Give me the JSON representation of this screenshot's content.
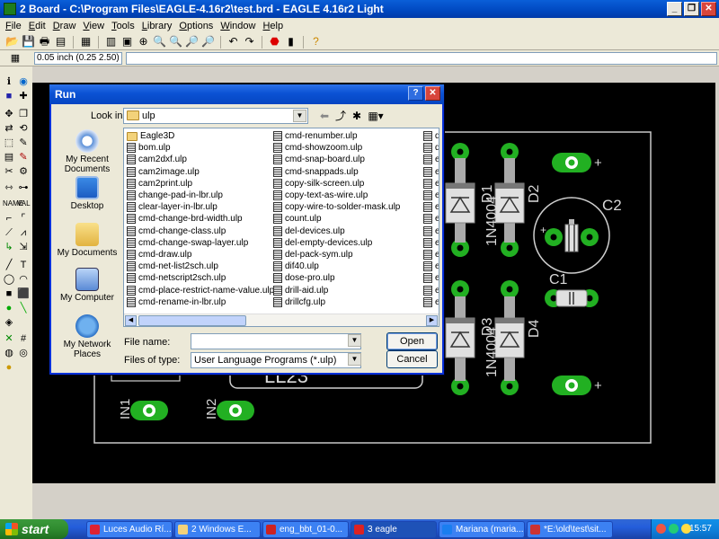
{
  "window": {
    "title": "2 Board - C:\\Program Files\\EAGLE-4.16r2\\test.brd - EAGLE 4.16r2 Light",
    "minimize": "_",
    "maximize": "❐",
    "close": "✕"
  },
  "menu": [
    "File",
    "Edit",
    "Draw",
    "View",
    "Tools",
    "Library",
    "Options",
    "Window",
    "Help"
  ],
  "toolbar_icons": [
    "open-icon",
    "save-icon",
    "print-icon",
    "cam-icon",
    "board-icon",
    "script-icon",
    "ulp-icon",
    "zoom-fit-icon",
    "zoom-in-icon",
    "zoom-out-icon",
    "zoom-redraw-icon",
    "zoom-area-icon",
    "undo-icon",
    "redo-icon",
    "stop-icon",
    "go-icon",
    "help-icon"
  ],
  "coordinates": "0.05 inch (0.25 2.50)",
  "pcb": {
    "labels": {
      "d1": "1N4004",
      "d1_ref": "D1",
      "d2": "D2",
      "c2": "C2",
      "c1": "C1",
      "d3": "1N4004",
      "d3_ref": "D3",
      "d4": "D4",
      "in1": "IN1",
      "in2": "IN2",
      "ll": "LL23",
      "plus1": "+",
      "plus2": "+",
      "plus3": "+"
    }
  },
  "run_dialog": {
    "title": "Run",
    "help_btn": "?",
    "close_btn": "✕",
    "look_in_label": "Look in:",
    "look_in_value": "ulp",
    "places": [
      "My Recent Documents",
      "Desktop",
      "My Documents",
      "My Computer",
      "My Network Places"
    ],
    "files_col1": [
      "Eagle3D",
      "bom.ulp",
      "cam2dxf.ulp",
      "cam2image.ulp",
      "cam2print.ulp",
      "change-pad-in-lbr.ulp",
      "clear-layer-in-lbr.ulp",
      "cmd-change-brd-width.ulp",
      "cmd-change-class.ulp",
      "cmd-change-swap-layer.ulp",
      "cmd-draw.ulp",
      "cmd-net-list2sch.ulp",
      "cmd-netscript2sch.ulp",
      "cmd-place-restrict-name-value.ulp",
      "cmd-rename-in-lbr.ulp"
    ],
    "files_col2": [
      "cmd-renumber.ulp",
      "cmd-showzoom.ulp",
      "cmd-snap-board.ulp",
      "cmd-snappads.ulp",
      "copy-silk-screen.ulp",
      "copy-text-as-wire.ulp",
      "copy-wire-to-solder-mask.ulp",
      "count.ulp",
      "del-devices.ulp",
      "del-empty-devices.ulp",
      "del-pack-sym.ulp",
      "dif40.ulp",
      "dose-pro.ulp",
      "drill-aid.ulp",
      "drillcfg.ulp"
    ],
    "files_col3": [
      "d",
      "d",
      "e",
      "e",
      "e",
      "e",
      "e",
      "e",
      "e",
      "e",
      "e",
      "e",
      "e",
      "e",
      "e"
    ],
    "file_name_label": "File name:",
    "file_name_value": "",
    "files_of_type_label": "Files of type:",
    "files_of_type_value": "User Language Programs (*.ulp)",
    "open_btn": "Open",
    "cancel_btn": "Cancel"
  },
  "taskbar": {
    "start": "start",
    "tasks": [
      "Luces Audio Rí...",
      "2 Windows E...",
      "eng_bbt_01-0...",
      "3 eagle",
      "Mariana (maria...",
      "*E:\\old\\test\\sit..."
    ],
    "clock": "15:57"
  }
}
